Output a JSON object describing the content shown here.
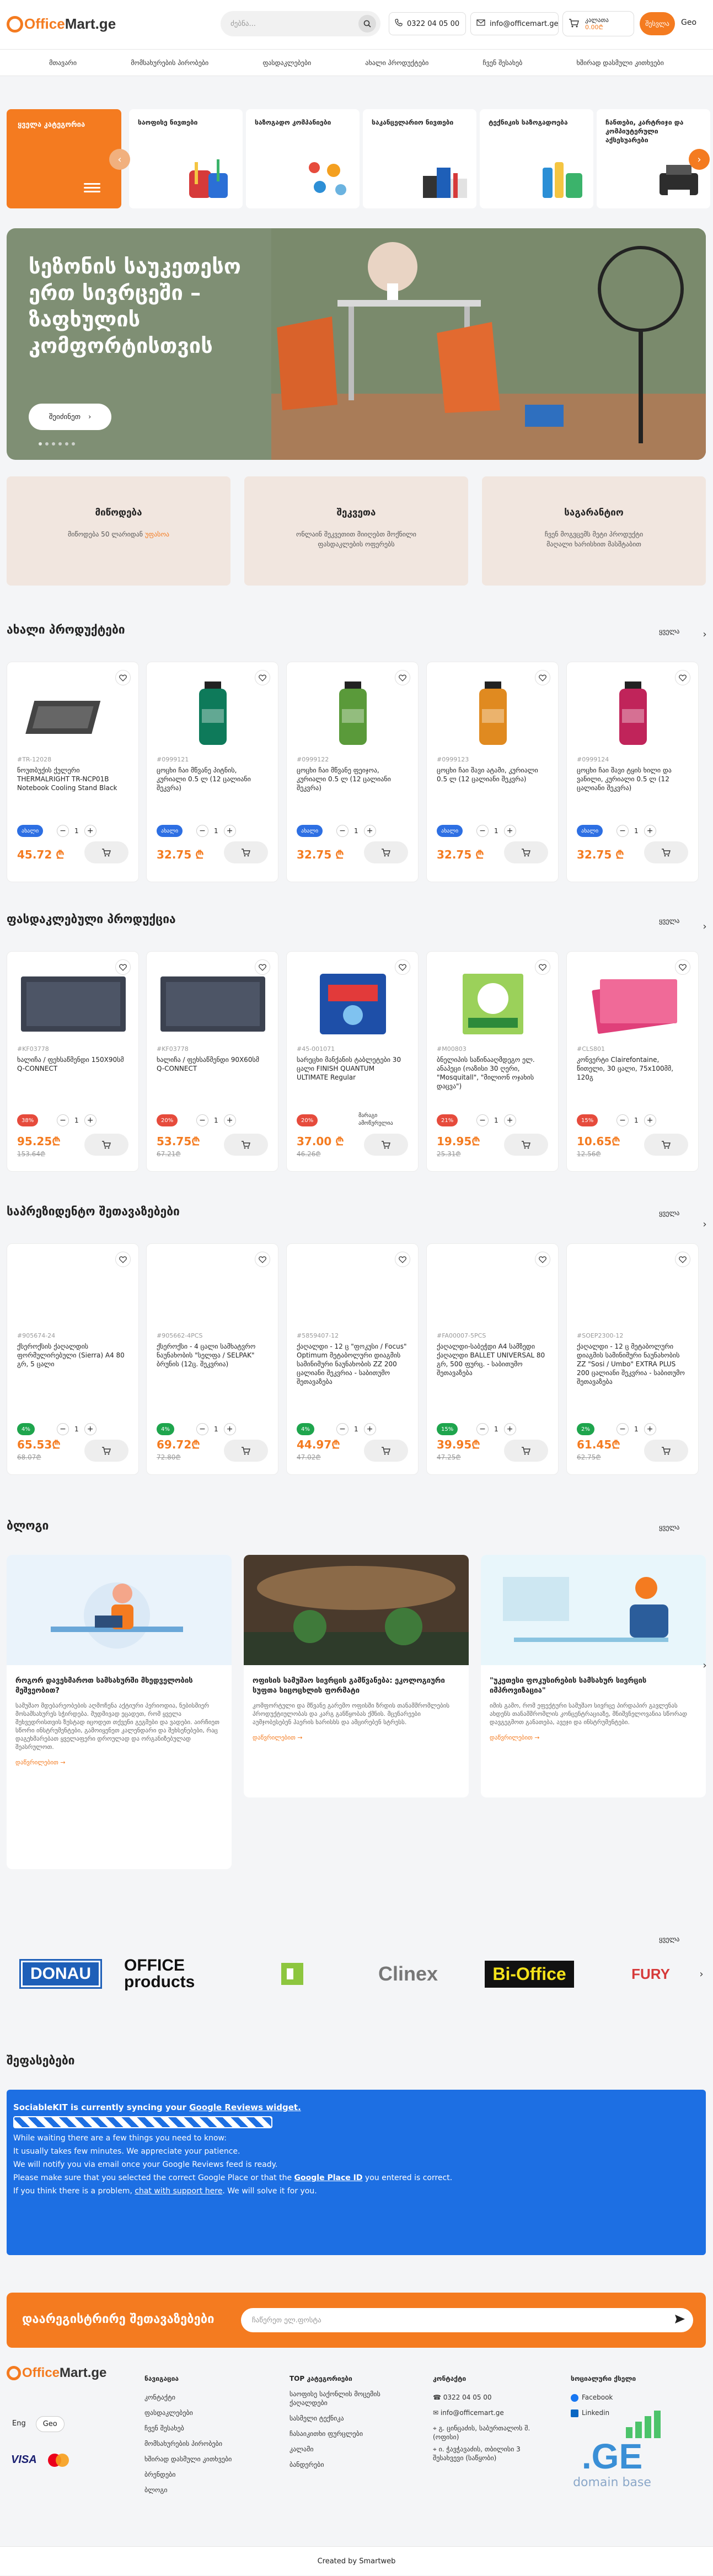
{
  "header": {
    "logo_part1": "Office",
    "logo_part2": "Mart.ge",
    "search_placeholder": "ძებნა...",
    "phone": "0322 04 05 00",
    "email": "info@officemart.ge",
    "cart_line1": "კალათა",
    "cart_line2": "0.00₾",
    "login_label": "შესვლა",
    "language": "Geo"
  },
  "nav": {
    "items": [
      "მთავარი",
      "მომსახურების პირობები",
      "ფასდაკლებები",
      "ახალი პროდუქტები",
      "ჩვენ შესახებ",
      "ხშირად დასმული კითხვები"
    ]
  },
  "categories": {
    "all_label": "ყველა კატეგორია",
    "items": [
      "საოფისე ნივთები",
      "საზოგადო კომპანიები",
      "საკანცელარიო ნივთები",
      "ტექნიკის საზოგადოება",
      "ჩანთები, კარტრიჯი და კომპიუტერული აქსესუარები"
    ]
  },
  "hero": {
    "title": "სეზონის საუკეთესო ერთ სივრცეში – ზაფხულის კომფორტისთვის",
    "button_label": "შეიძინეთ",
    "slide_count": 6
  },
  "info_blocks": [
    {
      "title": "მიწოდება",
      "text": "მიწოდება 50 ლარიდან",
      "link": "უფასოა"
    },
    {
      "title": "შეკვეთა",
      "text": "ონლაინ შეკვეთით მიიღებთ მოქნილი ფასდაკლების ოფერებს"
    },
    {
      "title": "საგარანტიო",
      "text": "ჩვენ მოგვცემს მეტი პროდუქტი მაღალი ხარისხით მასშტაბით"
    }
  ],
  "sections": {
    "see_all": "ყველა",
    "new_products": "ახალი პროდუქტები",
    "discounts": "ფასდაკლებული პროდუქცია",
    "special_offers": "საპრეზიდენტო შეთავაზებები",
    "blog": "ბლოგი",
    "reviews": "შეფასებები"
  },
  "new_products": [
    {
      "code": "#TR-12028",
      "name": "ნოუთბუქის ქულერი THERMALRIGHT TR-NCP01B Notebook Cooling Stand Black",
      "tag": "ახალი",
      "price": "45.72 ₾",
      "qty": "1"
    },
    {
      "code": "#0999121",
      "name": "ცოცხი ჩაი მწვანე პიტნის, კურიალი 0.5 ლ (12 ცალიანი შეკვრა)",
      "tag": "ახალი",
      "price": "32.75 ₾",
      "qty": "1"
    },
    {
      "code": "#0999122",
      "name": "ცოცხი ჩაი მწვანე ფეიჯოა, კურიალი 0.5 ლ (12 ცალიანი შეკვრა)",
      "tag": "ახალი",
      "price": "32.75 ₾",
      "qty": "1"
    },
    {
      "code": "#0999123",
      "name": "ცოცხი ჩაი შავი ატამი, კურიალი 0.5 ლ (12 ცალიანი შეკვრა)",
      "tag": "ახალი",
      "price": "32.75 ₾",
      "qty": "1"
    },
    {
      "code": "#0999124",
      "name": "ცოცხი ჩაი შავი ტყის ხილი და ვანილი, კურიალი 0.5 ლ (12 ცალიანი შეკვრა)",
      "tag": "ახალი",
      "price": "32.75 ₾",
      "qty": "1"
    }
  ],
  "discount_products": [
    {
      "code": "#KF03778",
      "name": "ხალიჩა / ფეხსაწმენდი 150X90სმ Q-CONNECT",
      "tag": "38%",
      "price": "95.25₾",
      "old": "153.64₾",
      "qty": "1"
    },
    {
      "code": "#KF03778",
      "name": "ხალიჩა / ფეხსაწმენდი 90X60სმ Q-CONNECT",
      "tag": "20%",
      "price": "53.75₾",
      "old": "67.21₾",
      "qty": "1"
    },
    {
      "code": "#45-001071",
      "name": "სარეცხი მანქანის ტაბლეტები 30 ცალი FINISH QUANTUM ULTIMATE Regular",
      "tag": "20%",
      "price": "37.00 ₾",
      "old": "46.26₾",
      "qty": "1",
      "note": "მარაგი ამოწურულია"
    },
    {
      "code": "#M00803",
      "name": "ბნელიპის საწინააღმდეგო ელ. ანაპეცი (ოაზისი 30 ღერი, \"Mosquitall\", \"მილიონ ოჯახის დაცვა\")",
      "tag": "21%",
      "price": "19.95₾",
      "old": "25.31₾",
      "qty": "1"
    },
    {
      "code": "#CLS801",
      "name": "კონვერტი Clairefontaine, წითელი, 30 ცალი, 75x100მმ, 120გ",
      "tag": "15%",
      "price": "10.65₾",
      "old": "12.56₾",
      "qty": "1"
    }
  ],
  "special_products": [
    {
      "code": "#905674-24",
      "name": "ქსეროქსის ქაღალდის ფორმულირებული (Sierra) A4 80 გრ, 5 ცალი",
      "tag": "4%",
      "price": "65.53₾",
      "old": "68.07₾",
      "qty": "1"
    },
    {
      "code": "#905662-4PCS",
      "name": "ქსეროქსი - 4 ცალი სამხატვრო ნაუნახობის \"სელფა / SELPAK\" ბრუნის (12ც. შეკვრია)",
      "tag": "4%",
      "price": "69.72₾",
      "old": "72.80₾",
      "qty": "1"
    },
    {
      "code": "#5859407-12",
      "name": "ქაღალდი - 12 ც \"ფოკუსი / Focus\" Optimum მეტაბოლური დიაგმის სამინიმური ნაუნახობის ZZ 200 ცალიანი შეკვრია - საბითუმო შეთავაზება",
      "tag": "4%",
      "price": "44.97₾",
      "old": "47.02₾",
      "qty": "1"
    },
    {
      "code": "#FA00007-5PCS",
      "name": "ქაღალდი-საბეჭდი A4 სამზედი ქაღალდი BALLET UNIVERSAL 80 გრ, 500 ფურც. - საბითუმო შეთავაზება",
      "tag": "15%",
      "price": "39.95₾",
      "old": "47.25₾",
      "qty": "1"
    },
    {
      "code": "#SOEP2300-12",
      "name": "ქაღალდი - 12 ც მეტაბოლური დიაგმის სამინიმური ნაუნახობის ZZ \"Sosi / Umbo\" EXTRA PLUS 200 ცალიანი შეკვრია - საბითუმო შეთავაზება",
      "tag": "2%",
      "price": "61.45₾",
      "old": "62.75₾",
      "qty": "1"
    }
  ],
  "blog_posts": [
    {
      "title": "როგორ დავეხმაროთ სამსახურში მხედველობის მეშვეობით?",
      "excerpt": "სამუშაო მდებარეობების აღმოჩენა აქტიური პერიოდია, ნებისმიერ მოსამსახურეს სჭირდება. მუდმივად ეცადეთ, რომ ყველა შეხვედრისთვის ზუსტად იცოდეთ თქვენი გეგმები და ვადები. აირჩიეთ სწორი ინსტრუმენტები, გამოიყენეთ კალენდარი და შეხსენებები, რაც დაგეხმარებათ ყველაფერი დროულად და ორგანიზებულად შეასრულოთ.",
      "more": "დაწვრილებით"
    },
    {
      "title": "ოფისის სამუშაო სივრცის გამწვანება: ეკოლოგიური სუფთა სიცოცხლის ფორმატი",
      "excerpt": "კომფორტული და მწვანე გარემო ოფისში ზრდის თანამშრომლების პროდუქტიულობას და კარგ განწყობას ქმნის. მცენარეები აუმჯობესებენ ჰაერის ხარისხს და ამცირებენ სტრესს.",
      "more": "დაწვრილებით"
    },
    {
      "title": "\"უკეთესი ფოკუსირების სამსახურ სივრცის იმპროვიზაცია\"",
      "excerpt": "იმის გამო, რომ ეფექტური სამუშაო სივრცე პირდაპირ გავლენას ახდენს თანამშრომლის კონცენტრაციაზე, მნიშვნელოვანია სწორად დავგეგმოთ განათება, ავეჯი და ინსტრუმენტები.",
      "more": "დაწვრილებით"
    }
  ],
  "brands": [
    "DONAU",
    "OFFICE products",
    "Clinex",
    "Bi-Office",
    "FURY"
  ],
  "reviews_widget": {
    "heading_pre": "SociableKIT is currently syncing your ",
    "heading_link": "Google Reviews widget.",
    "lines": [
      "While waiting there are a few things you need to know:",
      "It usually takes few minutes. We appreciate your patience.",
      "We will notify you via email once your Google Reviews feed is ready."
    ],
    "line4_pre": "Please make sure that you selected the correct Google Place or that the ",
    "line4_link": "Google Place ID",
    "line4_post": " you entered is correct.",
    "line5_pre": "If you think there is a problem, ",
    "line5_link": "chat with support here",
    "line5_post": ". We will solve it for you."
  },
  "newsletter": {
    "title": "დაარეგისტრირე შეთავაზებები",
    "placeholder": "ჩაწერეთ ელ.ფოსტა"
  },
  "footer": {
    "col1_title": "ნავიგაცია",
    "col1_items": [
      "კონტაქტი",
      "ფასდაკლებები",
      "ჩვენ შესახებ",
      "მომსახურების პირობები",
      "ხშირად დასმული კითხვები",
      "ბრენდები",
      "ბლოგი"
    ],
    "col2_title": "TOP კატეგორიები",
    "col2_items": [
      "საოფისე საქონლის მოცემის ქაღალდები",
      "სასმელი ტექნიკა",
      "ჩასაიკითხი ფურცლები",
      "კალამი",
      "ბანდერები"
    ],
    "col3_title": "კონტაქტი",
    "col3_items": [
      "0322 04 05 00",
      "info@officemart.ge",
      "გ. ცინცაძის, საბურთალოს შ. (ოფისი)",
      "ი. ჭავჭავაძის, თბილისი 3 შესახვევი (საწყობი)"
    ],
    "col4_title": "სოციალური ქსელი",
    "col4_items": [
      "Facebook",
      "Linkedin"
    ],
    "lang1": "Eng",
    "lang2": "Geo",
    "visa": "VISA",
    "ge_badge": ".GE",
    "ge_caption": "domain base",
    "credit": "Created by Smartweb"
  },
  "colors": {
    "accent": "#f47b20",
    "blue_tag": "#2d6fe3",
    "green_tag": "#1ea54d",
    "review_bg": "#1d6fe3"
  }
}
